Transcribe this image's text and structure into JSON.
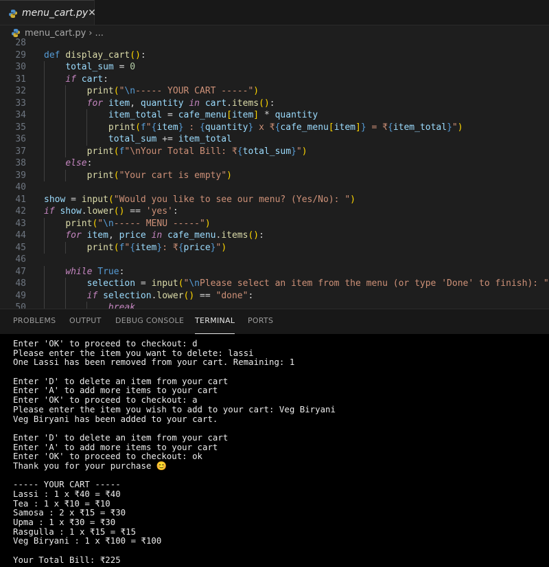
{
  "tab": {
    "filename": "menu_cart.py",
    "close": "✕"
  },
  "breadcrumb": {
    "file": "menu_cart.py",
    "sep": "›",
    "more": "..."
  },
  "editor": {
    "line_numbers": [
      "28",
      "29",
      "30",
      "31",
      "32",
      "33",
      "34",
      "35",
      "36",
      "37",
      "38",
      "39",
      "40",
      "41",
      "42",
      "43",
      "44",
      "45",
      "46",
      "47",
      "48",
      "49",
      "50"
    ],
    "lines": [
      "",
      "def display_cart():",
      "    total_sum = 0",
      "    if cart:",
      "        print(\"\\n----- YOUR CART -----\")",
      "        for item, quantity in cart.items():",
      "            item_total = cafe_menu[item] * quantity",
      "            print(f\"{item} : {quantity} x ₹{cafe_menu[item]} = ₹{item_total}\")",
      "            total_sum += item_total",
      "        print(f\"\\nYour Total Bill: ₹{total_sum}\")",
      "    else:",
      "        print(\"Your cart is empty\")",
      "",
      "show = input(\"Would you like to see our menu? (Yes/No): \")",
      "if show.lower() == 'yes':",
      "    print(\"\\n----- MENU -----\")",
      "    for item, price in cafe_menu.items():",
      "        print(f\"{item}: ₹{price}\")",
      "",
      "    while True:",
      "        selection = input(\"\\nPlease select an item from the menu (or type 'Done' to finish): \").title()",
      "        if selection.lower() == \"done\":",
      "            break"
    ]
  },
  "panel": {
    "tabs": [
      "PROBLEMS",
      "OUTPUT",
      "DEBUG CONSOLE",
      "TERMINAL",
      "PORTS"
    ],
    "active_tab": "TERMINAL"
  },
  "terminal": {
    "lines": [
      "Enter 'OK' to proceed to checkout: d",
      "Please enter the item you want to delete: lassi",
      "One Lassi has been removed from your cart. Remaining: 1",
      "",
      "Enter 'D' to delete an item from your cart",
      "Enter 'A' to add more items to your cart",
      "Enter 'OK' to proceed to checkout: a",
      "Please enter the item you wish to add to your cart: Veg Biryani",
      "Veg Biryani has been added to your cart.",
      "",
      "Enter 'D' to delete an item from your cart",
      "Enter 'A' to add more items to your cart",
      "Enter 'OK' to proceed to checkout: ok",
      "Thank you for your purchase 😊",
      "",
      "----- YOUR CART -----",
      "Lassi : 1 x ₹40 = ₹40",
      "Tea : 1 x ₹10 = ₹10",
      "Samosa : 2 x ₹15 = ₹30",
      "Upma : 1 x ₹30 = ₹30",
      "Rasgulla : 1 x ₹15 = ₹15",
      "Veg Biryani : 1 x ₹100 = ₹100",
      "",
      "Your Total Bill: ₹225"
    ]
  },
  "colors": {
    "editor_bg": "#1e1e1e",
    "terminal_bg": "#000000",
    "keyword": "#c586c0",
    "function": "#dcdcaa",
    "variable": "#9cdcfe",
    "string": "#ce9178",
    "number": "#b5cea8"
  }
}
